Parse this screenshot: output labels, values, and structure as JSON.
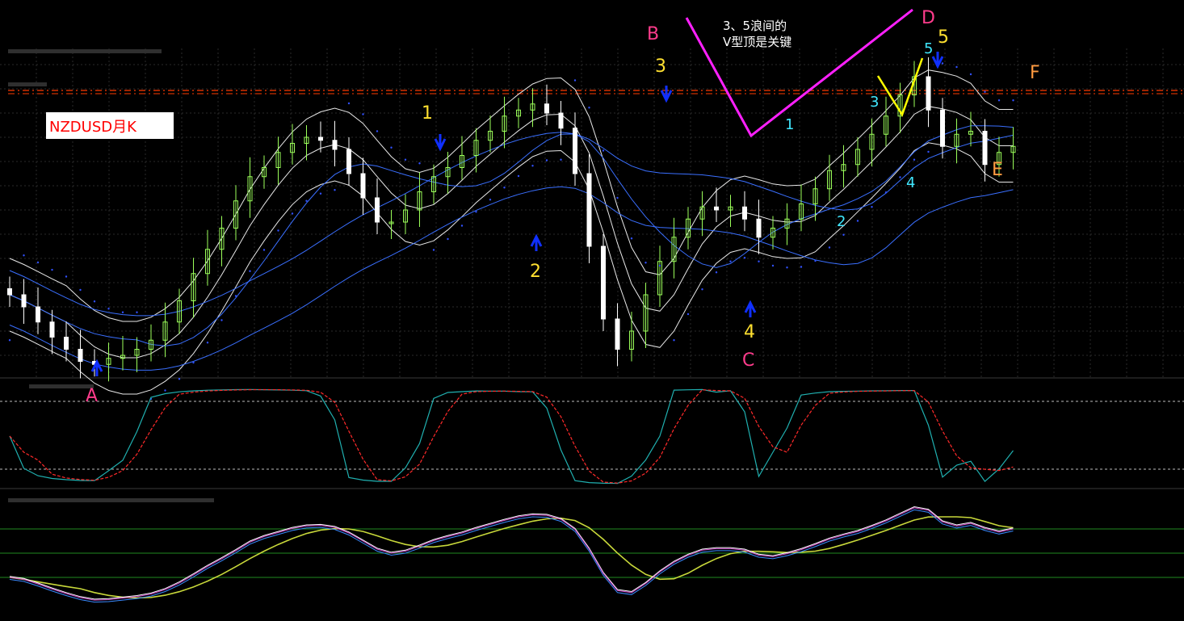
{
  "colors": {
    "background": "#000000",
    "grid": "#2a2a2a",
    "candle_up": "#9bff5a",
    "candle_down": "#ffffff",
    "ma_blue": "#3a6fff",
    "envelope_white": "#e8e8e8",
    "envelope_dots": "#3050ff",
    "resistance": "#ff3b00",
    "stoch_main": "#20b0b0",
    "stoch_signal": "#ff2a2a",
    "wave_arrow": "#1030ff",
    "v_top_magenta": "#ff20ff",
    "v_top_yellow": "#ffff00"
  },
  "symbol_label": "NZDUSD月K",
  "note": {
    "line1": "3、5浪间的",
    "line2": "V型顶是关键"
  },
  "labels": {
    "A": "A",
    "B": "B",
    "C": "C",
    "D": "D",
    "E": "E",
    "F": "F",
    "w1": "1",
    "w2": "2",
    "w3": "3",
    "w4": "4",
    "w5": "5",
    "s1": "1",
    "s2": "2",
    "s3": "3",
    "s4": "4",
    "s5": "5"
  },
  "chart_data": {
    "type": "candlestick",
    "title": "",
    "symbol": "NZDUSD",
    "timeframe": "月K",
    "price_close_approx": [
      0.62,
      0.6,
      0.575,
      0.55,
      0.53,
      0.51,
      0.505,
      0.515,
      0.52,
      0.53,
      0.545,
      0.575,
      0.61,
      0.655,
      0.695,
      0.73,
      0.775,
      0.815,
      0.83,
      0.855,
      0.87,
      0.88,
      0.875,
      0.86,
      0.82,
      0.78,
      0.74,
      0.74,
      0.76,
      0.79,
      0.815,
      0.83,
      0.85,
      0.875,
      0.89,
      0.915,
      0.925,
      0.935,
      0.92,
      0.895,
      0.82,
      0.7,
      0.58,
      0.53,
      0.56,
      0.62,
      0.675,
      0.715,
      0.745,
      0.765,
      0.76,
      0.765,
      0.745,
      0.715,
      0.73,
      0.745,
      0.77,
      0.795,
      0.825,
      0.835,
      0.86,
      0.885,
      0.915,
      0.95,
      0.98,
      0.925,
      0.865,
      0.885,
      0.89,
      0.835,
      0.855,
      0.865
    ],
    "wave_labels": [
      "1",
      "2",
      "3",
      "4",
      "5"
    ],
    "points": [
      "A",
      "B",
      "C",
      "D",
      "E",
      "F"
    ],
    "indicators": [
      "moving averages",
      "envelopes",
      "parabolic SAR",
      "stochastic"
    ]
  }
}
